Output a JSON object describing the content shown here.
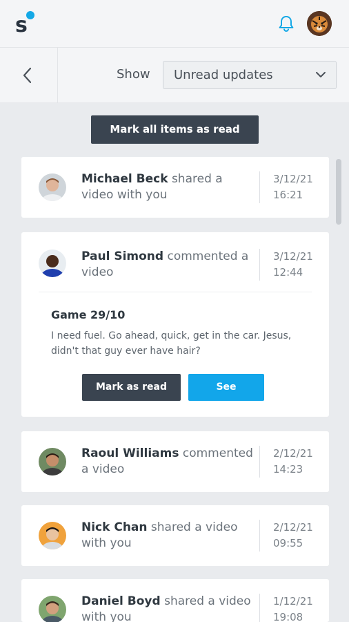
{
  "header": {
    "logo_text": "s",
    "notification_icon": "bell-icon",
    "avatar": "tiger-avatar"
  },
  "filter": {
    "show_label": "Show",
    "selected": "Unread updates"
  },
  "mark_all_label": "Mark all items as read",
  "notifications": [
    {
      "name": "Michael Beck",
      "action": "shared a video with you",
      "date": "3/12/21",
      "time": "16:21"
    },
    {
      "name": "Paul Simond",
      "action": "commented a video",
      "date": "3/12/21",
      "time": "12:44",
      "preview": {
        "title": "Game 29/10",
        "body": "I need fuel. Go ahead, quick, get in the car. Jesus, didn't that guy ever have hair?",
        "mark_read_label": "Mark as read",
        "see_label": "See"
      }
    },
    {
      "name": "Raoul Williams",
      "action": "commented a video",
      "date": "2/12/21",
      "time": "14:23"
    },
    {
      "name": "Nick Chan",
      "action": "shared a video with you",
      "date": "2/12/21",
      "time": "09:55"
    },
    {
      "name": "Daniel Boyd",
      "action": "shared a video with you",
      "date": "1/12/21",
      "time": "19:08"
    }
  ],
  "colors": {
    "primary_dark": "#3a4450",
    "accent_blue": "#12a6ea",
    "background": "#e9ebee"
  }
}
